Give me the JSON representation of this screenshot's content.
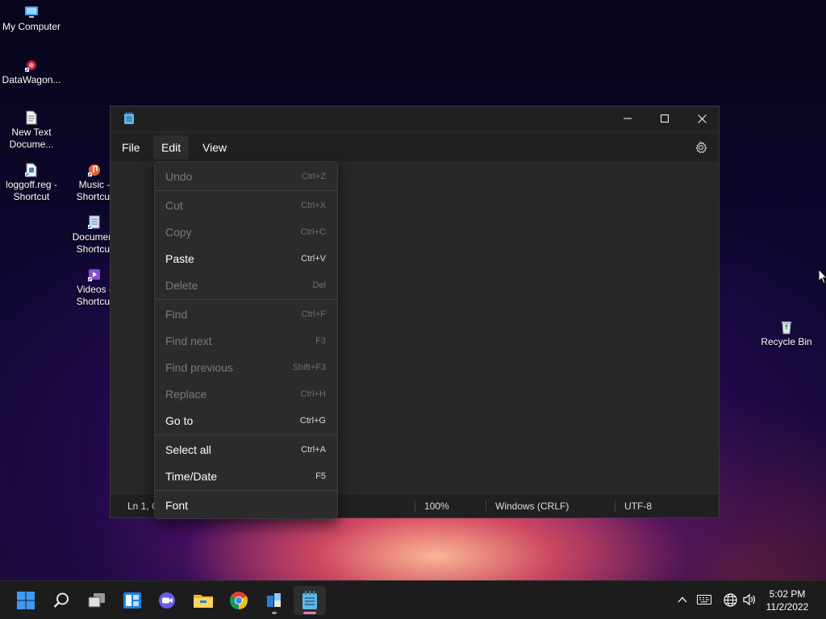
{
  "desktop": {
    "icons": [
      {
        "label": "My Computer"
      },
      {
        "label": "DataWagon..."
      },
      {
        "label": "New Text Docume..."
      },
      {
        "label": "loggoff.reg - Shortcut"
      },
      {
        "label": "Music - Shortcut"
      },
      {
        "label": "Document Shortcut"
      },
      {
        "label": "Videos - Shortcut"
      },
      {
        "label": "Recycle Bin"
      }
    ]
  },
  "notepad": {
    "menu": {
      "file": "File",
      "edit": "Edit",
      "view": "View"
    },
    "status": {
      "position": "Ln 1, C",
      "zoom": "100%",
      "line_ending": "Windows (CRLF)",
      "encoding": "UTF-8"
    }
  },
  "edit_menu": {
    "items": [
      {
        "label": "Undo",
        "shortcut": "Ctrl+Z"
      },
      {
        "label": "Cut",
        "shortcut": "Ctrl+X"
      },
      {
        "label": "Copy",
        "shortcut": "Ctrl+C"
      },
      {
        "label": "Paste",
        "shortcut": "Ctrl+V"
      },
      {
        "label": "Delete",
        "shortcut": "Del"
      },
      {
        "label": "Find",
        "shortcut": "Ctrl+F"
      },
      {
        "label": "Find next",
        "shortcut": "F3"
      },
      {
        "label": "Find previous",
        "shortcut": "Shift+F3"
      },
      {
        "label": "Replace",
        "shortcut": "Ctrl+H"
      },
      {
        "label": "Go to",
        "shortcut": "Ctrl+G"
      },
      {
        "label": "Select all",
        "shortcut": "Ctrl+A"
      },
      {
        "label": "Time/Date",
        "shortcut": "F5"
      },
      {
        "label": "Font",
        "shortcut": ""
      }
    ]
  },
  "taskbar": {
    "clock": {
      "time": "5:02 PM",
      "date": "11/2/2022"
    }
  },
  "colors": {
    "accent_pink": "#e879b6",
    "start_blue": "#3b9bf5"
  }
}
